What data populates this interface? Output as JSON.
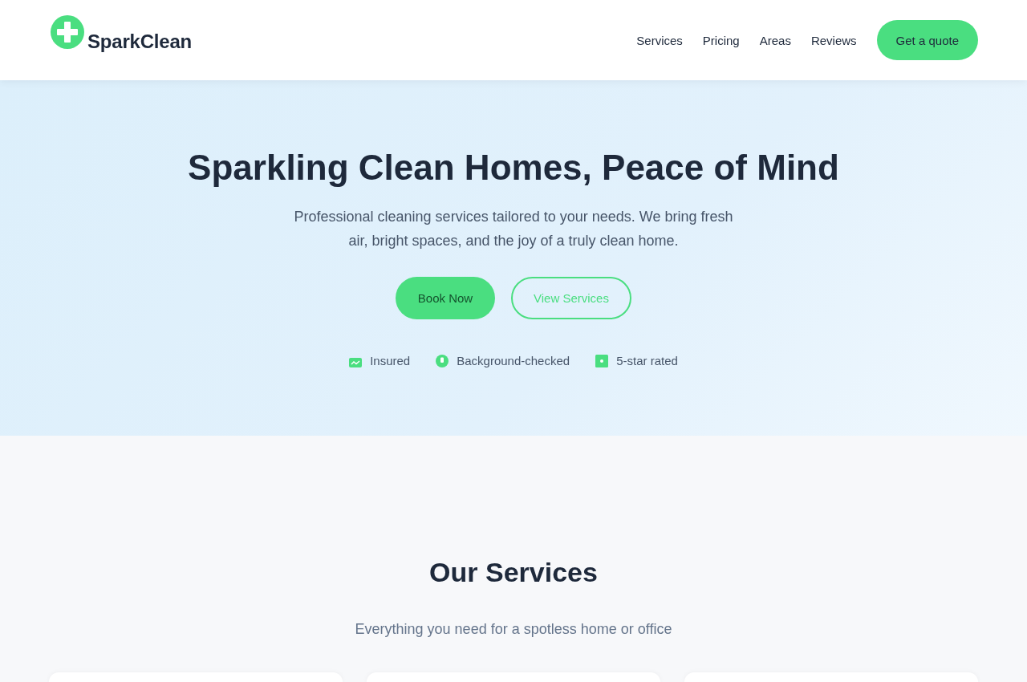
{
  "header": {
    "logo": {
      "name": "SparkClean"
    },
    "nav": [
      {
        "label": "Services"
      },
      {
        "label": "Pricing"
      },
      {
        "label": "Areas"
      },
      {
        "label": "Reviews"
      }
    ],
    "cta": {
      "label": "Get a quote"
    }
  },
  "hero": {
    "title": "Sparkling Clean Homes, Peace of Mind",
    "subtitle": "Professional cleaning services tailored to your needs. We bring fresh air, bright spaces, and the joy of a truly clean home.",
    "buttons": [
      {
        "label": "Book Now",
        "kind": "primary"
      },
      {
        "label": "View Services",
        "kind": "outline"
      }
    ],
    "badges": [
      {
        "label": "Insured",
        "kind": "insured"
      },
      {
        "label": "Background-checked",
        "kind": "checked"
      },
      {
        "label": "5-star rated",
        "kind": "rated"
      }
    ]
  },
  "services": {
    "title": "Our Services",
    "subtitle": "Everything you need for a spotless home or office",
    "cards": [
      {
        "kind": "service"
      },
      {
        "kind": "service"
      },
      {
        "kind": "service"
      }
    ]
  }
}
